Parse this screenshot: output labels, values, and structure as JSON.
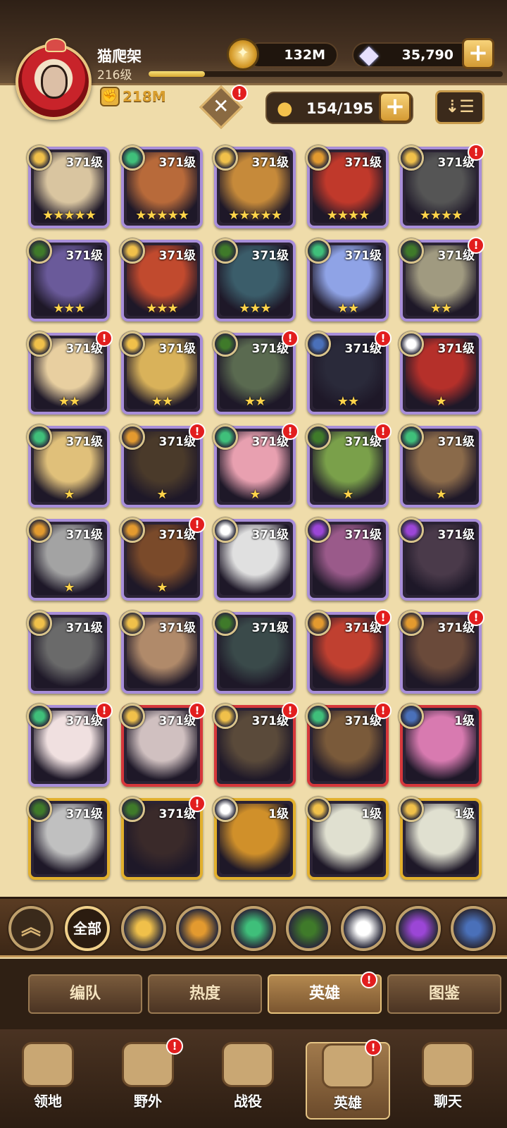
{
  "player": {
    "name": "猫爬架",
    "level": "216级",
    "xp_progress": 0.16,
    "power": "218M"
  },
  "currency": {
    "gold": "132M",
    "gems": "35,790"
  },
  "hero_count": "154/195",
  "colors": {
    "voyager": "#bcd2ff",
    "lightbearer": "#f0c04a",
    "maulers": "#e39a2f",
    "wilders": "#3fbf7a",
    "graveborn": "#3f7a2a",
    "celestial": "#ffffff",
    "hypogean": "#9b46d6",
    "dimensional": "#4a70b9"
  },
  "heroes": [
    {
      "level": "371级",
      "stars": "★★★★★",
      "faction": "lightbearer",
      "frame": "purple",
      "alert": false,
      "tint": "#d9c5a0"
    },
    {
      "level": "371级",
      "stars": "★★★★★",
      "faction": "wilders",
      "frame": "purple",
      "alert": false,
      "tint": "#b86a3a"
    },
    {
      "level": "371级",
      "stars": "★★★★★",
      "faction": "lightbearer",
      "frame": "purple",
      "alert": false,
      "tint": "#c68a3a"
    },
    {
      "level": "371级",
      "stars": "★★★★",
      "faction": "maulers",
      "frame": "purple",
      "alert": false,
      "tint": "#c0392b"
    },
    {
      "level": "371级",
      "stars": "★★★★",
      "faction": "lightbearer",
      "frame": "purple",
      "alert": true,
      "tint": "#555"
    },
    {
      "level": "371级",
      "stars": "★★★",
      "faction": "graveborn",
      "frame": "purple",
      "alert": false,
      "tint": "#6a5a9a"
    },
    {
      "level": "371级",
      "stars": "★★★",
      "faction": "lightbearer",
      "frame": "purple",
      "alert": false,
      "tint": "#c14a2e"
    },
    {
      "level": "371级",
      "stars": "★★★",
      "faction": "graveborn",
      "frame": "purple",
      "alert": false,
      "tint": "#3b5d6a"
    },
    {
      "level": "371级",
      "stars": "★★",
      "faction": "wilders",
      "frame": "purple",
      "alert": false,
      "tint": "#8fa3e6"
    },
    {
      "level": "371级",
      "stars": "★★",
      "faction": "graveborn",
      "frame": "purple",
      "alert": true,
      "tint": "#a09a80"
    },
    {
      "level": "371级",
      "stars": "★★",
      "faction": "lightbearer",
      "frame": "purple",
      "alert": true,
      "tint": "#e8cfa0"
    },
    {
      "level": "371级",
      "stars": "★★",
      "faction": "lightbearer",
      "frame": "purple",
      "alert": false,
      "tint": "#d9b25a"
    },
    {
      "level": "371级",
      "stars": "★★",
      "faction": "graveborn",
      "frame": "purple",
      "alert": true,
      "tint": "#5a6a50"
    },
    {
      "level": "371级",
      "stars": "★★",
      "faction": "dimensional",
      "frame": "purple",
      "alert": true,
      "tint": "#2a2a3a"
    },
    {
      "level": "371级",
      "stars": "★",
      "faction": "celestial",
      "frame": "purple",
      "alert": false,
      "tint": "#b5302a"
    },
    {
      "level": "371级",
      "stars": "★",
      "faction": "wilders",
      "frame": "purple",
      "alert": false,
      "tint": "#e0c07a"
    },
    {
      "level": "371级",
      "stars": "★",
      "faction": "maulers",
      "frame": "purple",
      "alert": true,
      "tint": "#4a3a2a"
    },
    {
      "level": "371级",
      "stars": "★",
      "faction": "wilders",
      "frame": "purple",
      "alert": true,
      "tint": "#e8a0b0"
    },
    {
      "level": "371级",
      "stars": "★",
      "faction": "graveborn",
      "frame": "purple",
      "alert": true,
      "tint": "#7aa04a"
    },
    {
      "level": "371级",
      "stars": "★",
      "faction": "wilders",
      "frame": "purple",
      "alert": false,
      "tint": "#8a6a4a"
    },
    {
      "level": "371级",
      "stars": "★",
      "faction": "maulers",
      "frame": "purple",
      "alert": false,
      "tint": "#a3a3a3"
    },
    {
      "level": "371级",
      "stars": "★",
      "faction": "maulers",
      "frame": "purple",
      "alert": true,
      "tint": "#7a4a2a"
    },
    {
      "level": "371级",
      "stars": "",
      "faction": "celestial",
      "frame": "purple",
      "alert": false,
      "tint": "#e0e0e0"
    },
    {
      "level": "371级",
      "stars": "",
      "faction": "hypogean",
      "frame": "purple",
      "alert": false,
      "tint": "#9a5a8a"
    },
    {
      "level": "371级",
      "stars": "",
      "faction": "hypogean",
      "frame": "purple",
      "alert": false,
      "tint": "#4a3a4a"
    },
    {
      "level": "371级",
      "stars": "",
      "faction": "lightbearer",
      "frame": "purple",
      "alert": false,
      "tint": "#6a6a6a"
    },
    {
      "level": "371级",
      "stars": "",
      "faction": "lightbearer",
      "frame": "purple",
      "alert": false,
      "tint": "#b08a6a"
    },
    {
      "level": "371级",
      "stars": "",
      "faction": "graveborn",
      "frame": "purple",
      "alert": false,
      "tint": "#3a4a4a"
    },
    {
      "level": "371级",
      "stars": "",
      "faction": "maulers",
      "frame": "purple",
      "alert": true,
      "tint": "#c04030"
    },
    {
      "level": "371级",
      "stars": "",
      "faction": "maulers",
      "frame": "purple",
      "alert": true,
      "tint": "#6a4a3a"
    },
    {
      "level": "371级",
      "stars": "",
      "faction": "wilders",
      "frame": "purple",
      "alert": true,
      "tint": "#f0e0e0"
    },
    {
      "level": "371级",
      "stars": "",
      "faction": "lightbearer",
      "frame": "red",
      "alert": true,
      "tint": "#d0c0c0"
    },
    {
      "level": "371级",
      "stars": "",
      "faction": "lightbearer",
      "frame": "red",
      "alert": true,
      "tint": "#5a4a3a"
    },
    {
      "level": "371级",
      "stars": "",
      "faction": "wilders",
      "frame": "red",
      "alert": true,
      "tint": "#7a5a3a"
    },
    {
      "level": "1级",
      "stars": "",
      "faction": "dimensional",
      "frame": "red",
      "alert": false,
      "tint": "#d87ab0"
    },
    {
      "level": "371级",
      "stars": "",
      "faction": "graveborn",
      "frame": "gold",
      "alert": false,
      "tint": "#c0c0c0"
    },
    {
      "level": "371级",
      "stars": "",
      "faction": "graveborn",
      "frame": "gold",
      "alert": true,
      "tint": "#3a2a2a"
    },
    {
      "level": "1级",
      "stars": "",
      "faction": "celestial",
      "frame": "gold",
      "alert": false,
      "tint": "#d0902a"
    },
    {
      "level": "1级",
      "stars": "",
      "faction": "lightbearer",
      "frame": "gold",
      "alert": false,
      "tint": "#e0e0d0"
    },
    {
      "level": "1级",
      "stars": "",
      "faction": "lightbearer",
      "frame": "gold",
      "alert": false,
      "tint": "#e0e0d0"
    }
  ],
  "faction_filter": {
    "all_label": "全部",
    "icons": [
      "lightbearer-icon",
      "maulers-icon",
      "wilders-icon",
      "graveborn-icon",
      "celestial-icon",
      "hypogean-icon",
      "dimensional-icon"
    ]
  },
  "tabs": [
    {
      "label": "编队",
      "active": false,
      "alert": false
    },
    {
      "label": "热度",
      "active": false,
      "alert": false
    },
    {
      "label": "英雄",
      "active": true,
      "alert": true
    },
    {
      "label": "图鉴",
      "active": false,
      "alert": false
    }
  ],
  "nav": [
    {
      "label": "领地",
      "alert": false,
      "active": false
    },
    {
      "label": "野外",
      "alert": true,
      "active": false
    },
    {
      "label": "战役",
      "alert": false,
      "active": false
    },
    {
      "label": "英雄",
      "alert": true,
      "active": true
    },
    {
      "label": "聊天",
      "alert": false,
      "active": false
    }
  ]
}
